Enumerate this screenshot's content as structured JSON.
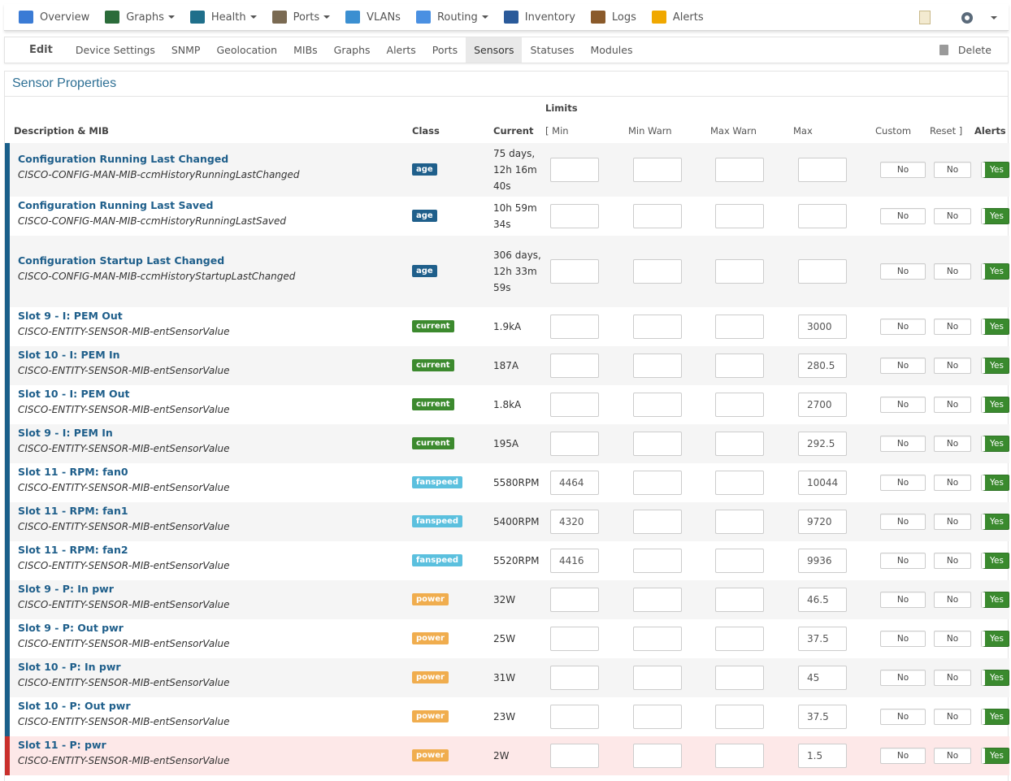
{
  "navbar": {
    "items": [
      {
        "label": "Overview",
        "icon": "overview-icon",
        "color": "#3a7bd5",
        "caret": false
      },
      {
        "label": "Graphs",
        "icon": "graphs-icon",
        "color": "#2b6c3a",
        "caret": true
      },
      {
        "label": "Health",
        "icon": "health-icon",
        "color": "#1f6f8b",
        "caret": true
      },
      {
        "label": "Ports",
        "icon": "ports-icon",
        "color": "#7a6a52",
        "caret": true
      },
      {
        "label": "VLANs",
        "icon": "vlans-icon",
        "color": "#3b8fd1",
        "caret": false
      },
      {
        "label": "Routing",
        "icon": "routing-icon",
        "color": "#4a90e2",
        "caret": true
      },
      {
        "label": "Inventory",
        "icon": "inventory-icon",
        "color": "#2a5a9a",
        "caret": false
      },
      {
        "label": "Logs",
        "icon": "logs-icon",
        "color": "#8a5a2a",
        "caret": false
      },
      {
        "label": "Alerts",
        "icon": "alerts-icon",
        "color": "#f0a800",
        "caret": false
      }
    ]
  },
  "tabs": {
    "edit_label": "Edit",
    "items": [
      "Device Settings",
      "SNMP",
      "Geolocation",
      "MIBs",
      "Graphs",
      "Alerts",
      "Ports",
      "Sensors",
      "Statuses",
      "Modules"
    ],
    "active": "Sensors",
    "delete_label": "Delete"
  },
  "panel": {
    "title": "Sensor Properties"
  },
  "headers": {
    "limits": "Limits",
    "desc": "Description & MIB",
    "class": "Class",
    "current": "Current",
    "min": "[ Min",
    "min_warn": "Min Warn",
    "max_warn": "Max Warn",
    "max": "Max",
    "custom": "Custom",
    "reset": "Reset ]",
    "alerts": "Alerts"
  },
  "toggles": {
    "no": "No",
    "yes": "Yes"
  },
  "rows": [
    {
      "title": "Configuration Running Last Changed",
      "mib": "CISCO-CONFIG-MAN-MIB-ccmHistoryRunningLastChanged",
      "class": "age",
      "current": "75 days, 12h 16m 40s",
      "min": "",
      "max": ""
    },
    {
      "title": "Configuration Running Last Saved",
      "mib": "CISCO-CONFIG-MAN-MIB-ccmHistoryRunningLastSaved",
      "class": "age",
      "current": "10h 59m 34s",
      "min": "",
      "max": ""
    },
    {
      "title": "Configuration Startup Last Changed",
      "mib": "CISCO-CONFIG-MAN-MIB-ccmHistoryStartupLastChanged",
      "class": "age",
      "current": "306 days, 12h 33m 59s",
      "min": "",
      "max": ""
    },
    {
      "title": "Slot 9 - I: PEM Out",
      "mib": "CISCO-ENTITY-SENSOR-MIB-entSensorValue",
      "class": "current",
      "current": "1.9kA",
      "min": "",
      "max": "3000"
    },
    {
      "title": "Slot 10 - I: PEM In",
      "mib": "CISCO-ENTITY-SENSOR-MIB-entSensorValue",
      "class": "current",
      "current": "187A",
      "min": "",
      "max": "280.5"
    },
    {
      "title": "Slot 10 - I: PEM Out",
      "mib": "CISCO-ENTITY-SENSOR-MIB-entSensorValue",
      "class": "current",
      "current": "1.8kA",
      "min": "",
      "max": "2700"
    },
    {
      "title": "Slot 9 - I: PEM In",
      "mib": "CISCO-ENTITY-SENSOR-MIB-entSensorValue",
      "class": "current",
      "current": "195A",
      "min": "",
      "max": "292.5"
    },
    {
      "title": "Slot 11 - RPM: fan0",
      "mib": "CISCO-ENTITY-SENSOR-MIB-entSensorValue",
      "class": "fanspeed",
      "current": "5580RPM",
      "min": "4464",
      "max": "10044"
    },
    {
      "title": "Slot 11 - RPM: fan1",
      "mib": "CISCO-ENTITY-SENSOR-MIB-entSensorValue",
      "class": "fanspeed",
      "current": "5400RPM",
      "min": "4320",
      "max": "9720"
    },
    {
      "title": "Slot 11 - RPM: fan2",
      "mib": "CISCO-ENTITY-SENSOR-MIB-entSensorValue",
      "class": "fanspeed",
      "current": "5520RPM",
      "min": "4416",
      "max": "9936"
    },
    {
      "title": "Slot 9 - P: In pwr",
      "mib": "CISCO-ENTITY-SENSOR-MIB-entSensorValue",
      "class": "power",
      "current": "32W",
      "min": "",
      "max": "46.5"
    },
    {
      "title": "Slot 9 - P: Out pwr",
      "mib": "CISCO-ENTITY-SENSOR-MIB-entSensorValue",
      "class": "power",
      "current": "25W",
      "min": "",
      "max": "37.5"
    },
    {
      "title": "Slot 10 - P: In pwr",
      "mib": "CISCO-ENTITY-SENSOR-MIB-entSensorValue",
      "class": "power",
      "current": "31W",
      "min": "",
      "max": "45"
    },
    {
      "title": "Slot 10 - P: Out pwr",
      "mib": "CISCO-ENTITY-SENSOR-MIB-entSensorValue",
      "class": "power",
      "current": "23W",
      "min": "",
      "max": "37.5"
    },
    {
      "title": "Slot 11 - P: pwr",
      "mib": "CISCO-ENTITY-SENSOR-MIB-entSensorValue",
      "class": "power",
      "current": "2W",
      "min": "",
      "max": "1.5",
      "alarm": true
    }
  ]
}
